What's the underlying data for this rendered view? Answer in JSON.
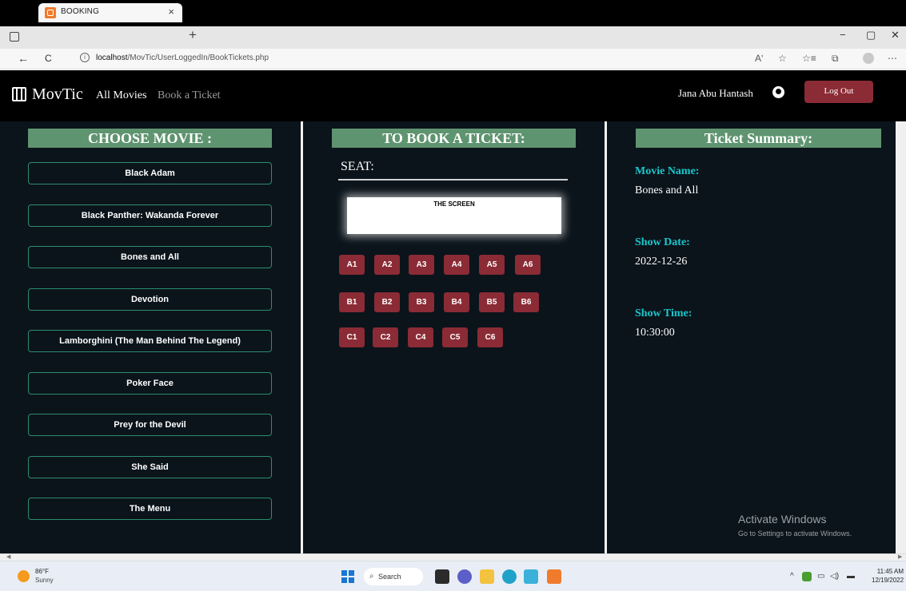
{
  "browser": {
    "tab_title": "BOOKING",
    "tab_close": "×",
    "new_tab": "+",
    "url_host": "localhost",
    "url_path": "/MovTic/UserLoggedIn/BookTickets.php",
    "window_controls": [
      "−",
      "▢",
      "✕"
    ],
    "nav_buttons": [
      "←",
      "C"
    ],
    "toolbar_icons": [
      "Aʹ",
      "☆",
      "☆≡",
      "⧉",
      "⋯"
    ]
  },
  "site": {
    "logo": "MovTic",
    "nav": [
      {
        "label": "All Movies",
        "color": "#ffffff"
      },
      {
        "label": "Book a Ticket",
        "color": "#9a9a9a"
      }
    ],
    "user_name": "Jana Abu Hantash",
    "logout_label": "Log Out"
  },
  "movies": {
    "title": "CHOOSE MOVIE :",
    "items": [
      "Black Adam",
      "Black Panther: Wakanda Forever",
      "Bones and All",
      "Devotion",
      "Lamborghini (The Man Behind The Legend)",
      "Poker Face",
      "Prey for the Devil",
      "She Said",
      "The Menu"
    ]
  },
  "booking": {
    "title": "TO BOOK A TICKET:",
    "seat_label": "SEAT:",
    "screen_label": "THE SCREEN",
    "rows": [
      [
        "A1",
        "A2",
        "A3",
        "A4",
        "A5",
        "A6"
      ],
      [
        "B1",
        "B2",
        "B3",
        "B4",
        "B5",
        "B6"
      ],
      [
        "C1",
        "C2",
        "C4",
        "C5",
        "C6"
      ]
    ]
  },
  "summary": {
    "title": "Ticket Summary:",
    "movie_label": "Movie Name:",
    "movie_value": "Bones and All",
    "date_label": "Show Date:",
    "date_value": "2022-12-26",
    "time_label": "Show Time:",
    "time_value": "10:30:00"
  },
  "watermark": {
    "title": "Activate Windows",
    "subtitle": "Go to Settings to activate Windows."
  },
  "taskbar": {
    "temperature": "86°F",
    "weather": "Sunny",
    "search_label": "Search",
    "time": "11:45 AM",
    "date": "12/19/2022"
  },
  "colors": {
    "page_bg": "#0b141b",
    "title_bg": "#5f9470",
    "accent_red": "#8b2b35",
    "summary_label": "#18c7cc",
    "movie_border": "#2e8b70"
  }
}
